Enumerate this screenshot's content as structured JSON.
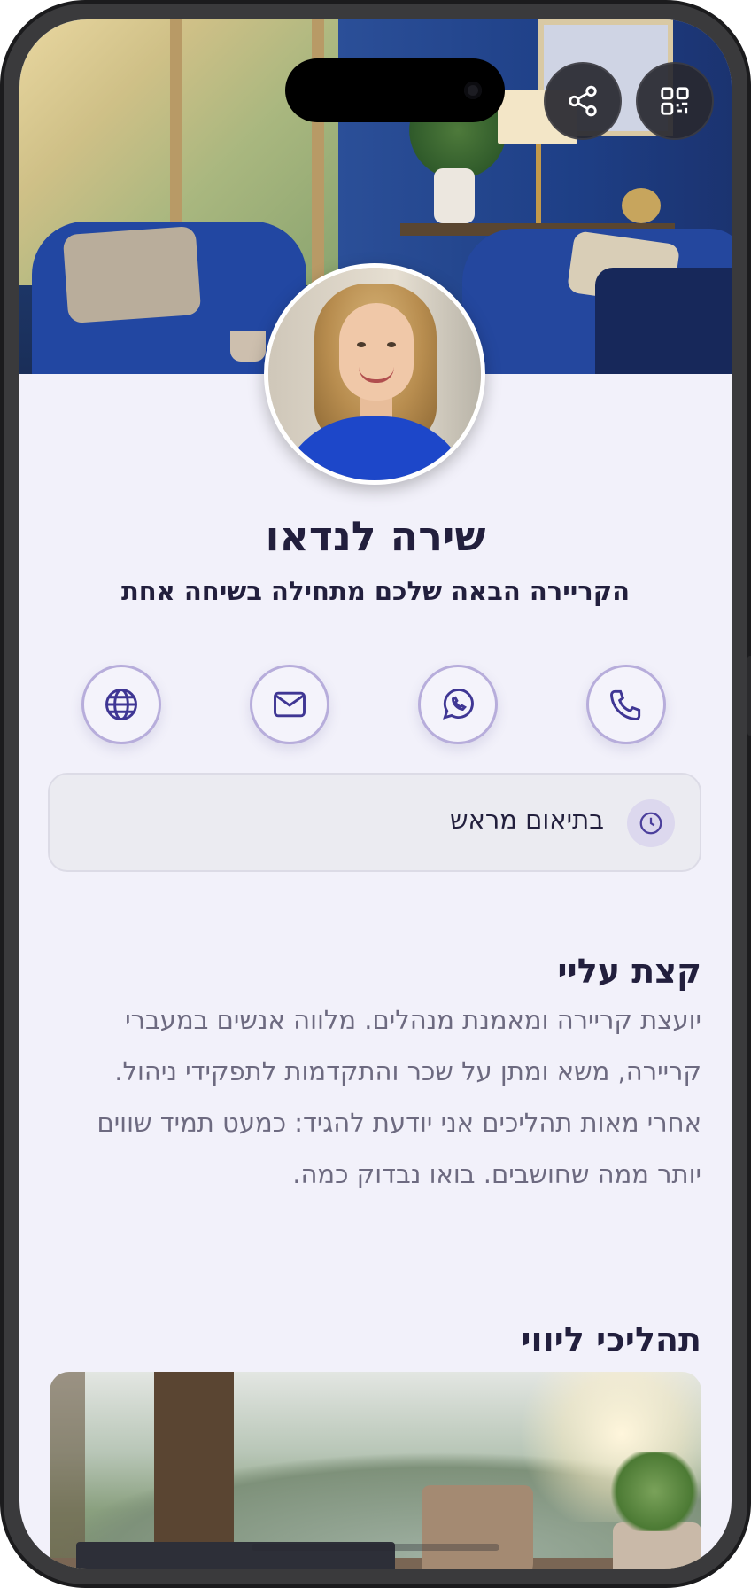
{
  "profile": {
    "name": "שירה לנדאו",
    "tagline": "הקריירה הבאה שלכם מתחילה בשיחה אחת"
  },
  "header": {
    "share_icon": "share-icon",
    "qr_icon": "qr-code-icon"
  },
  "contact_buttons": [
    {
      "icon": "globe-icon"
    },
    {
      "icon": "mail-icon"
    },
    {
      "icon": "whatsapp-icon"
    },
    {
      "icon": "phone-icon"
    }
  ],
  "hours": {
    "text": "בתיאום מראש",
    "icon": "clock-icon"
  },
  "about": {
    "title": "קצת עליי",
    "body": "יועצת קריירה ומאמנת מנהלים. מלווה אנשים במעברי קריירה, משא ומתן על שכר והתקדמות לתפקידי ניהול. אחרי מאות תהליכים אני יודעת להגיד: כמעט תמיד שווים יותר ממה שחושבים. בואו נבדוק כמה."
  },
  "processes": {
    "title": "תהליכי ליווי"
  },
  "colors": {
    "accent": "#4b3f9c",
    "background": "#f2f1fa",
    "text": "#221f3d"
  }
}
